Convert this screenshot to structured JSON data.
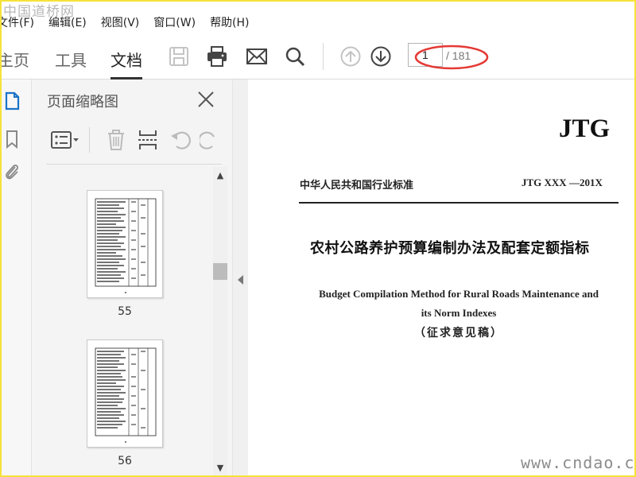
{
  "watermark": {
    "top": "中国道桥网",
    "bottom": "www.cndao.com"
  },
  "menu": [
    {
      "label": "文件(F)"
    },
    {
      "label": "编辑(E)"
    },
    {
      "label": "视图(V)"
    },
    {
      "label": "窗口(W)"
    },
    {
      "label": "帮助(H)"
    }
  ],
  "tabs": [
    {
      "label": "主页"
    },
    {
      "label": "工具"
    },
    {
      "label": "文档",
      "active": true
    }
  ],
  "toolbar": {
    "icons": [
      "save-icon",
      "print-icon",
      "email-icon",
      "search-icon",
      "page-up-icon",
      "page-down-icon"
    ],
    "page_current": "1",
    "page_total": "/ 181"
  },
  "left_rail": {
    "icons": [
      "page-thumbnails-icon",
      "bookmarks-icon",
      "attachments-icon"
    ]
  },
  "thumb_panel": {
    "title": "页面缩略图",
    "tools": [
      "options-icon",
      "delete-icon",
      "extract-icon",
      "rotate-left-icon",
      "rotate-right-icon"
    ],
    "pages": [
      {
        "label": "55"
      },
      {
        "label": "56"
      }
    ]
  },
  "document": {
    "brand": "JTG",
    "standard_left": "中华人民共和国行业标准",
    "standard_right": "JTG XXX —201X",
    "title_cn": "农村公路养护预算编制办法及配套定额指标",
    "title_en_line1": "Budget Compilation Method for Rural Roads Maintenance and",
    "title_en_line2": "its Norm Indexes",
    "draft": "（征求意见稿）"
  },
  "colors": {
    "frame": "#f5e23a",
    "annotation": "#e53935",
    "accent": "#333333"
  }
}
